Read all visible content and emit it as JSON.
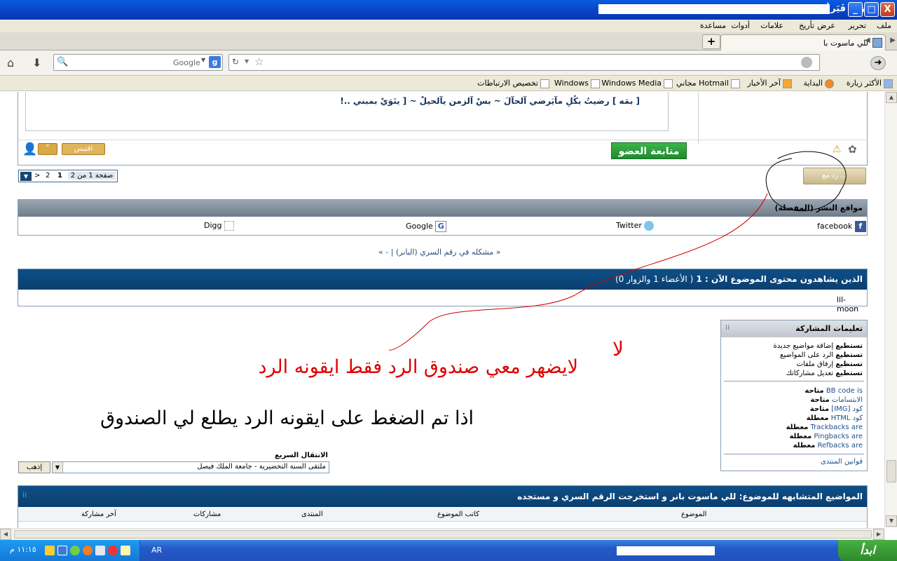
{
  "window": {
    "title": "موزيلا فَيَرفُكس",
    "minimize": "_",
    "maximize": "□",
    "close": "X"
  },
  "menu": [
    "ملف",
    "تحرير",
    "عرض",
    "تأريخ",
    "علامات",
    "أدوات",
    "مساعدة"
  ],
  "tabs": {
    "active_title": "للي ماسوت با",
    "new_tab": "+"
  },
  "search": {
    "placeholder": "Google"
  },
  "bookmarks": [
    {
      "label": "الأكثر زيارة"
    },
    {
      "label": "البداية"
    },
    {
      "label": "آخر الأخبار"
    },
    {
      "label": "Hotmail مجاني"
    },
    {
      "label": "Windows Media"
    },
    {
      "label": "Windows"
    },
    {
      "label": "تخصيص الارتباطات"
    }
  ],
  "post": {
    "signature": "[ بمَه ] رضيتُ بكُلِ مآيَرضي آلحآلَ ~ بسْ آلزمن يآلحيلْ ~ [ يتَوَيْ بمبني ..!",
    "follow_button": "متابعة العضو",
    "quote_button": "اقتبس",
    "multi_quote": "\" ",
    "reply_button": "رد مع ..."
  },
  "pagination": {
    "label": "صفحة 1 من 2",
    "pages": [
      "1",
      "2"
    ],
    "next": ">"
  },
  "share": {
    "header": "مواقع النشر (المفضلة)",
    "sites": [
      "facebook",
      "Twitter",
      "Google",
      "Digg"
    ]
  },
  "thread_nav": "« مشكله في رقم السري (البانر) | - »",
  "viewers": {
    "header_bold": "الذين يشاهدون محتوى الموضوع الآن : 1",
    "header_rest": "( الأعضاء 1 والزوار 0)",
    "user": "lil-moon"
  },
  "permissions": {
    "title": "تعليمات المشاركة",
    "lines": [
      {
        "bold": "تستطيع",
        "rest": " إضافة مواضيع جديدة"
      },
      {
        "bold": "تستطيع",
        "rest": " الرد على المواضيع"
      },
      {
        "bold": "تستطيع",
        "rest": " إرفاق ملفات"
      },
      {
        "bold": "تستطيع",
        "rest": " تعديل مشاركاتك"
      }
    ],
    "codes": [
      {
        "label": "BB code is",
        "state": "متاحة"
      },
      {
        "label": "الابتسامات",
        "state": "متاحة"
      },
      {
        "label": "كود [IMG]",
        "state": "متاحة"
      },
      {
        "label": "كود HTML",
        "state": "معطلة"
      },
      {
        "label": "Trackbacks are",
        "state": "معطلة"
      },
      {
        "label": "Pingbacks are",
        "state": "معطلة"
      },
      {
        "label": "Refbacks are",
        "state": "معطلة"
      }
    ],
    "rules": "قوانين المنتدى"
  },
  "annotations": {
    "line1": "لايضهر معي صندوق الرد فقط ايقونه الرد",
    "line2": "اذا تم الضغط على ايقونه الرد يطلع لي الصندوق",
    "no": "لا"
  },
  "quick_nav": {
    "title": "الانتقال السريع",
    "selected": "ملتقى السنة التحضيرية - جامعة الملك فيصل",
    "go": "إذهب"
  },
  "similar": {
    "title": "المواضيع المتشابهه للموضوع: للي ماسوت بانر و استخرجت الرقم السري و مستجده",
    "columns": [
      "الموضوع",
      "كاتب الموضوع",
      "المنتدى",
      "مشاركات",
      "آخر مشاركة"
    ]
  },
  "taskbar": {
    "start": "ابدأ",
    "lang": "AR",
    "clock": "١١:١٥ م"
  },
  "colors": {
    "title_blue": "#0843c4",
    "forum_blue": "#0a3f70",
    "follow_green": "#2e9a3a",
    "annotation_red": "#cc0000"
  }
}
